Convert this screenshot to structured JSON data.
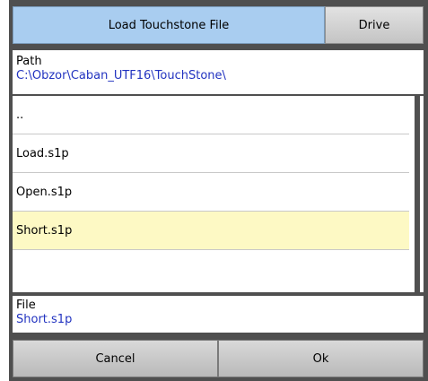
{
  "dialog": {
    "title": "Load Touchstone File",
    "drive_label": "Drive"
  },
  "path": {
    "label": "Path",
    "value": "C:\\Obzor\\Caban_UTF16\\TouchStone\\"
  },
  "files": [
    {
      "name": ".."
    },
    {
      "name": "Load.s1p"
    },
    {
      "name": "Open.s1p"
    },
    {
      "name": "Short.s1p"
    },
    {
      "name": ""
    }
  ],
  "file": {
    "label": "File",
    "value": "Short.s1p"
  },
  "buttons": {
    "cancel": "Cancel",
    "ok": "Ok"
  },
  "colors": {
    "title_bg": "#a9cdf0",
    "selected_row": "#fdf9c4",
    "path_text": "#2233c0",
    "frame": "#4f4f4f"
  }
}
